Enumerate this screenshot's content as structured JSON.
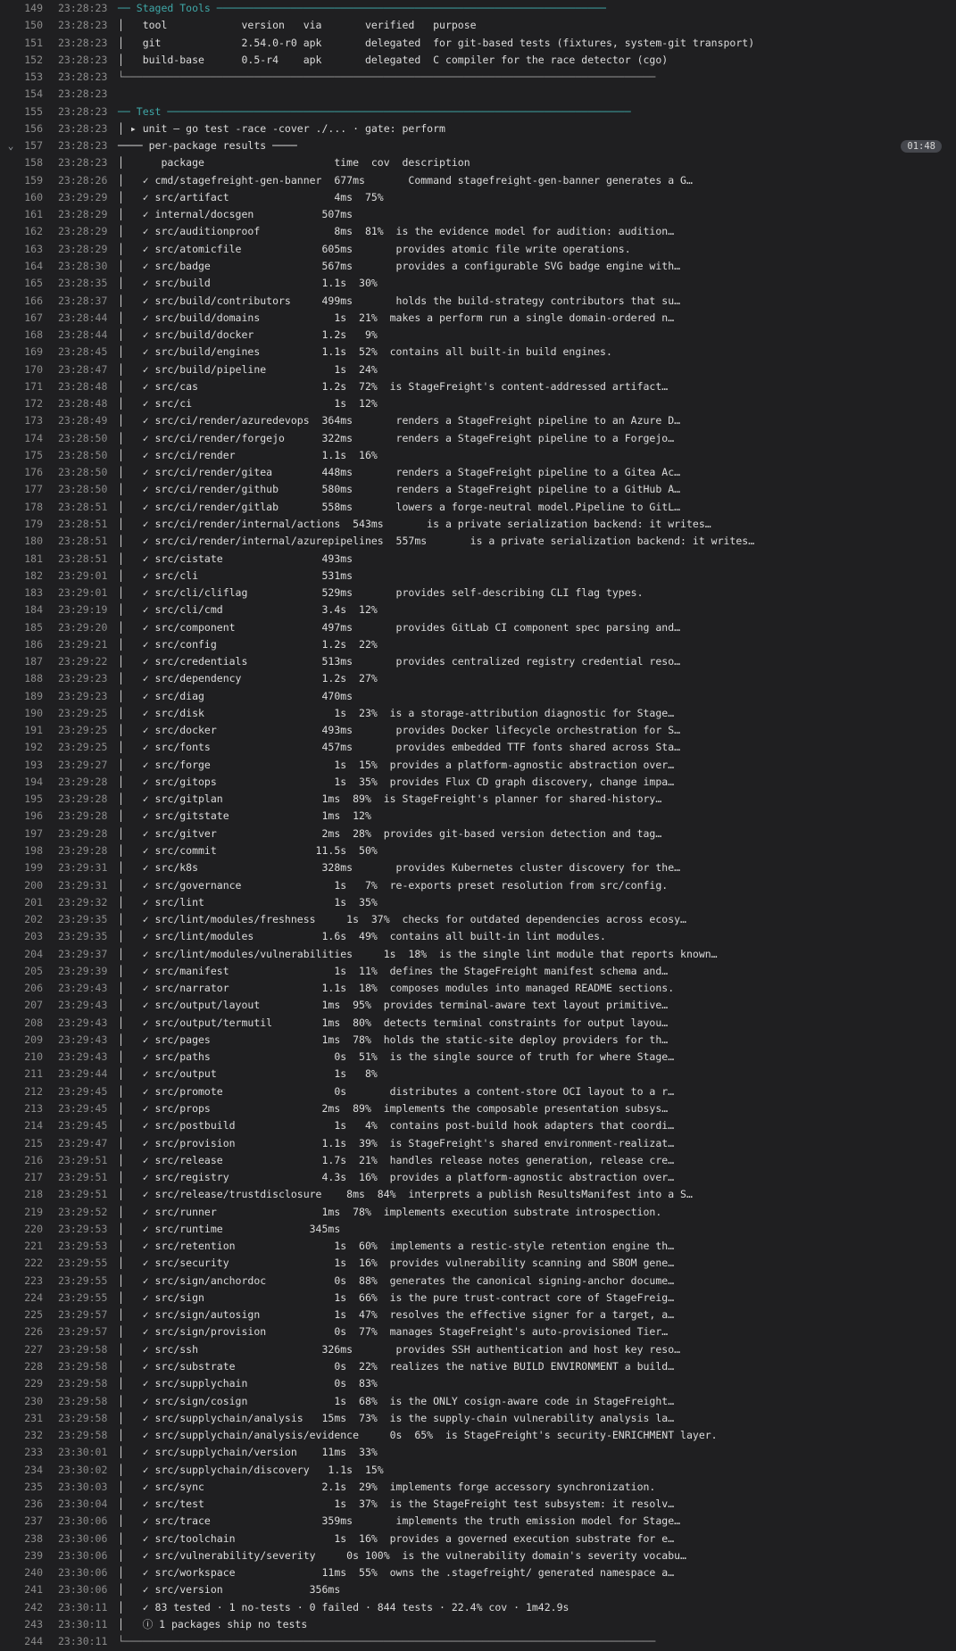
{
  "duration_badge": "01:48",
  "rows": [
    {
      "ln": "149",
      "ts": "23:28:23",
      "content": "── Staged Tools ───────────────────────────────────────────────────────────────",
      "style": "teal"
    },
    {
      "ln": "150",
      "ts": "23:28:23",
      "content": "│   tool            version   via       verified   purpose"
    },
    {
      "ln": "151",
      "ts": "23:28:23",
      "content": "│   git             2.54.0-r0 apk       delegated  for git-based tests (fixtures, system-git transport)"
    },
    {
      "ln": "152",
      "ts": "23:28:23",
      "content": "│   build-base      0.5-r4    apk       delegated  C compiler for the race detector (cgo)"
    },
    {
      "ln": "153",
      "ts": "23:28:23",
      "content": "└──────────────────────────────────────────────────────────────────────────────────────",
      "style": "frame"
    },
    {
      "ln": "154",
      "ts": "23:28:23",
      "content": ""
    },
    {
      "ln": "155",
      "ts": "23:28:23",
      "content": "── Test ───────────────────────────────────────────────────────────────────────────",
      "style": "teal"
    },
    {
      "ln": "156",
      "ts": "23:28:23",
      "content": "│ ▸ unit — go test -race -cover ./... · gate: perform"
    },
    {
      "ln": "157",
      "ts": "23:28:23",
      "content": "──── per-package results ────",
      "header": true
    },
    {
      "ln": "158",
      "ts": "23:28:23",
      "content": "│      package                     time  cov  description"
    },
    {
      "ln": "159",
      "ts": "23:28:26",
      "content": "│   ✓ cmd/stagefreight-gen-banner  677ms       Command stagefreight-gen-banner generates a G…"
    },
    {
      "ln": "160",
      "ts": "23:29:29",
      "content": "│   ✓ src/artifact                 4ms  75%"
    },
    {
      "ln": "161",
      "ts": "23:28:29",
      "content": "│   ✓ internal/docsgen           507ms"
    },
    {
      "ln": "162",
      "ts": "23:28:29",
      "content": "│   ✓ src/auditionproof            8ms  81%  is the evidence model for audition: audition…"
    },
    {
      "ln": "163",
      "ts": "23:28:29",
      "content": "│   ✓ src/atomicfile             605ms       provides atomic file write operations."
    },
    {
      "ln": "164",
      "ts": "23:28:30",
      "content": "│   ✓ src/badge                  567ms       provides a configurable SVG badge engine with…"
    },
    {
      "ln": "165",
      "ts": "23:28:35",
      "content": "│   ✓ src/build                  1.1s  30%"
    },
    {
      "ln": "166",
      "ts": "23:28:37",
      "content": "│   ✓ src/build/contributors     499ms       holds the build-strategy contributors that su…"
    },
    {
      "ln": "167",
      "ts": "23:28:44",
      "content": "│   ✓ src/build/domains            1s  21%  makes a perform run a single domain-ordered n…"
    },
    {
      "ln": "168",
      "ts": "23:28:44",
      "content": "│   ✓ src/build/docker           1.2s   9%"
    },
    {
      "ln": "169",
      "ts": "23:28:45",
      "content": "│   ✓ src/build/engines          1.1s  52%  contains all built-in build engines."
    },
    {
      "ln": "170",
      "ts": "23:28:47",
      "content": "│   ✓ src/build/pipeline           1s  24%"
    },
    {
      "ln": "171",
      "ts": "23:28:48",
      "content": "│   ✓ src/cas                    1.2s  72%  is StageFreight's content-addressed artifact…"
    },
    {
      "ln": "172",
      "ts": "23:28:48",
      "content": "│   ✓ src/ci                       1s  12%"
    },
    {
      "ln": "173",
      "ts": "23:28:49",
      "content": "│   ✓ src/ci/render/azuredevops  364ms       renders a StageFreight pipeline to an Azure D…"
    },
    {
      "ln": "174",
      "ts": "23:28:50",
      "content": "│   ✓ src/ci/render/forgejo      322ms       renders a StageFreight pipeline to a Forgejo…"
    },
    {
      "ln": "175",
      "ts": "23:28:50",
      "content": "│   ✓ src/ci/render              1.1s  16%"
    },
    {
      "ln": "176",
      "ts": "23:28:50",
      "content": "│   ✓ src/ci/render/gitea        448ms       renders a StageFreight pipeline to a Gitea Ac…"
    },
    {
      "ln": "177",
      "ts": "23:28:50",
      "content": "│   ✓ src/ci/render/github       580ms       renders a StageFreight pipeline to a GitHub A…"
    },
    {
      "ln": "178",
      "ts": "23:28:51",
      "content": "│   ✓ src/ci/render/gitlab       558ms       lowers a forge-neutral model.Pipeline to GitL…"
    },
    {
      "ln": "179",
      "ts": "23:28:51",
      "content": "│   ✓ src/ci/render/internal/actions  543ms       is a private serialization backend: it writes…"
    },
    {
      "ln": "180",
      "ts": "23:28:51",
      "content": "│   ✓ src/ci/render/internal/azurepipelines  557ms       is a private serialization backend: it writes…"
    },
    {
      "ln": "181",
      "ts": "23:28:51",
      "content": "│   ✓ src/cistate                493ms"
    },
    {
      "ln": "182",
      "ts": "23:29:01",
      "content": "│   ✓ src/cli                    531ms"
    },
    {
      "ln": "183",
      "ts": "23:29:01",
      "content": "│   ✓ src/cli/cliflag            529ms       provides self-describing CLI flag types."
    },
    {
      "ln": "184",
      "ts": "23:29:19",
      "content": "│   ✓ src/cli/cmd                3.4s  12%"
    },
    {
      "ln": "185",
      "ts": "23:29:20",
      "content": "│   ✓ src/component              497ms       provides GitLab CI component spec parsing and…"
    },
    {
      "ln": "186",
      "ts": "23:29:21",
      "content": "│   ✓ src/config                 1.2s  22%"
    },
    {
      "ln": "187",
      "ts": "23:29:22",
      "content": "│   ✓ src/credentials            513ms       provides centralized registry credential reso…"
    },
    {
      "ln": "188",
      "ts": "23:29:23",
      "content": "│   ✓ src/dependency             1.2s  27%"
    },
    {
      "ln": "189",
      "ts": "23:29:23",
      "content": "│   ✓ src/diag                   470ms"
    },
    {
      "ln": "190",
      "ts": "23:29:25",
      "content": "│   ✓ src/disk                     1s  23%  is a storage-attribution diagnostic for Stage…"
    },
    {
      "ln": "191",
      "ts": "23:29:25",
      "content": "│   ✓ src/docker                 493ms       provides Docker lifecycle orchestration for S…"
    },
    {
      "ln": "192",
      "ts": "23:29:25",
      "content": "│   ✓ src/fonts                  457ms       provides embedded TTF fonts shared across Sta…"
    },
    {
      "ln": "193",
      "ts": "23:29:27",
      "content": "│   ✓ src/forge                    1s  15%  provides a platform-agnostic abstraction over…"
    },
    {
      "ln": "194",
      "ts": "23:29:28",
      "content": "│   ✓ src/gitops                   1s  35%  provides Flux CD graph discovery, change impa…"
    },
    {
      "ln": "195",
      "ts": "23:29:28",
      "content": "│   ✓ src/gitplan                1ms  89%  is StageFreight's planner for shared-history…"
    },
    {
      "ln": "196",
      "ts": "23:29:28",
      "content": "│   ✓ src/gitstate               1ms  12%"
    },
    {
      "ln": "197",
      "ts": "23:29:28",
      "content": "│   ✓ src/gitver                 2ms  28%  provides git-based version detection and tag…"
    },
    {
      "ln": "198",
      "ts": "23:29:28",
      "content": "│   ✓ src/commit                11.5s  50%"
    },
    {
      "ln": "199",
      "ts": "23:29:31",
      "content": "│   ✓ src/k8s                    328ms       provides Kubernetes cluster discovery for the…"
    },
    {
      "ln": "200",
      "ts": "23:29:31",
      "content": "│   ✓ src/governance               1s   7%  re-exports preset resolution from src/config."
    },
    {
      "ln": "201",
      "ts": "23:29:32",
      "content": "│   ✓ src/lint                     1s  35%"
    },
    {
      "ln": "202",
      "ts": "23:29:35",
      "content": "│   ✓ src/lint/modules/freshness     1s  37%  checks for outdated dependencies across ecosy…"
    },
    {
      "ln": "203",
      "ts": "23:29:35",
      "content": "│   ✓ src/lint/modules           1.6s  49%  contains all built-in lint modules."
    },
    {
      "ln": "204",
      "ts": "23:29:37",
      "content": "│   ✓ src/lint/modules/vulnerabilities     1s  18%  is the single lint module that reports known…"
    },
    {
      "ln": "205",
      "ts": "23:29:39",
      "content": "│   ✓ src/manifest                 1s  11%  defines the StageFreight manifest schema and…"
    },
    {
      "ln": "206",
      "ts": "23:29:43",
      "content": "│   ✓ src/narrator               1.1s  18%  composes modules into managed README sections."
    },
    {
      "ln": "207",
      "ts": "23:29:43",
      "content": "│   ✓ src/output/layout          1ms  95%  provides terminal-aware text layout primitive…"
    },
    {
      "ln": "208",
      "ts": "23:29:43",
      "content": "│   ✓ src/output/termutil        1ms  80%  detects terminal constraints for output layou…"
    },
    {
      "ln": "209",
      "ts": "23:29:43",
      "content": "│   ✓ src/pages                  1ms  78%  holds the static-site deploy providers for th…"
    },
    {
      "ln": "210",
      "ts": "23:29:43",
      "content": "│   ✓ src/paths                    0s  51%  is the single source of truth for where Stage…"
    },
    {
      "ln": "211",
      "ts": "23:29:44",
      "content": "│   ✓ src/output                   1s   8%"
    },
    {
      "ln": "212",
      "ts": "23:29:45",
      "content": "│   ✓ src/promote                  0s       distributes a content-store OCI layout to a r…"
    },
    {
      "ln": "213",
      "ts": "23:29:45",
      "content": "│   ✓ src/props                  2ms  89%  implements the composable presentation subsys…"
    },
    {
      "ln": "214",
      "ts": "23:29:45",
      "content": "│   ✓ src/postbuild                1s   4%  contains post-build hook adapters that coordi…"
    },
    {
      "ln": "215",
      "ts": "23:29:47",
      "content": "│   ✓ src/provision              1.1s  39%  is StageFreight's shared environment-realizat…"
    },
    {
      "ln": "216",
      "ts": "23:29:51",
      "content": "│   ✓ src/release                1.7s  21%  handles release notes generation, release cre…"
    },
    {
      "ln": "217",
      "ts": "23:29:51",
      "content": "│   ✓ src/registry               4.3s  16%  provides a platform-agnostic abstraction over…"
    },
    {
      "ln": "218",
      "ts": "23:29:51",
      "content": "│   ✓ src/release/trustdisclosure    8ms  84%  interprets a publish ResultsManifest into a S…"
    },
    {
      "ln": "219",
      "ts": "23:29:52",
      "content": "│   ✓ src/runner                 1ms  78%  implements execution substrate introspection."
    },
    {
      "ln": "220",
      "ts": "23:29:53",
      "content": "│   ✓ src/runtime              345ms"
    },
    {
      "ln": "221",
      "ts": "23:29:53",
      "content": "│   ✓ src/retention                1s  60%  implements a restic-style retention engine th…"
    },
    {
      "ln": "222",
      "ts": "23:29:55",
      "content": "│   ✓ src/security                 1s  16%  provides vulnerability scanning and SBOM gene…"
    },
    {
      "ln": "223",
      "ts": "23:29:55",
      "content": "│   ✓ src/sign/anchordoc           0s  88%  generates the canonical signing-anchor docume…"
    },
    {
      "ln": "224",
      "ts": "23:29:55",
      "content": "│   ✓ src/sign                     1s  66%  is the pure trust-contract core of StageFreig…"
    },
    {
      "ln": "225",
      "ts": "23:29:57",
      "content": "│   ✓ src/sign/autosign            1s  47%  resolves the effective signer for a target, a…"
    },
    {
      "ln": "226",
      "ts": "23:29:57",
      "content": "│   ✓ src/sign/provision           0s  77%  manages StageFreight's auto-provisioned Tier…"
    },
    {
      "ln": "227",
      "ts": "23:29:58",
      "content": "│   ✓ src/ssh                    326ms       provides SSH authentication and host key reso…"
    },
    {
      "ln": "228",
      "ts": "23:29:58",
      "content": "│   ✓ src/substrate                0s  22%  realizes the native BUILD ENVIRONMENT a build…"
    },
    {
      "ln": "229",
      "ts": "23:29:58",
      "content": "│   ✓ src/supplychain              0s  83%"
    },
    {
      "ln": "230",
      "ts": "23:29:58",
      "content": "│   ✓ src/sign/cosign              1s  68%  is the ONLY cosign-aware code in StageFreight…"
    },
    {
      "ln": "231",
      "ts": "23:29:58",
      "content": "│   ✓ src/supplychain/analysis   15ms  73%  is the supply-chain vulnerability analysis la…"
    },
    {
      "ln": "232",
      "ts": "23:29:58",
      "content": "│   ✓ src/supplychain/analysis/evidence     0s  65%  is StageFreight's security-ENRICHMENT layer."
    },
    {
      "ln": "233",
      "ts": "23:30:01",
      "content": "│   ✓ src/supplychain/version    11ms  33%"
    },
    {
      "ln": "234",
      "ts": "23:30:02",
      "content": "│   ✓ src/supplychain/discovery   1.1s  15%"
    },
    {
      "ln": "235",
      "ts": "23:30:03",
      "content": "│   ✓ src/sync                   2.1s  29%  implements forge accessory synchronization."
    },
    {
      "ln": "236",
      "ts": "23:30:04",
      "content": "│   ✓ src/test                     1s  37%  is the StageFreight test subsystem: it resolv…"
    },
    {
      "ln": "237",
      "ts": "23:30:06",
      "content": "│   ✓ src/trace                  359ms       implements the truth emission model for Stage…"
    },
    {
      "ln": "238",
      "ts": "23:30:06",
      "content": "│   ✓ src/toolchain                1s  16%  provides a governed execution substrate for e…"
    },
    {
      "ln": "239",
      "ts": "23:30:06",
      "content": "│   ✓ src/vulnerability/severity     0s 100%  is the vulnerability domain's severity vocabu…"
    },
    {
      "ln": "240",
      "ts": "23:30:06",
      "content": "│   ✓ src/workspace              11ms  55%  owns the .stagefreight/ generated namespace a…"
    },
    {
      "ln": "241",
      "ts": "23:30:06",
      "content": "│   ✓ src/version              356ms"
    },
    {
      "ln": "242",
      "ts": "23:30:11",
      "content": "│   ✓ 83 tested · 1 no-tests · 0 failed · 844 tests · 22.4% cov · 1m42.9s"
    },
    {
      "ln": "243",
      "ts": "23:30:11",
      "content": "│   ⓘ 1 packages ship no tests"
    },
    {
      "ln": "244",
      "ts": "23:30:11",
      "content": "└──────────────────────────────────────────────────────────────────────────────────────",
      "style": "frame"
    }
  ]
}
